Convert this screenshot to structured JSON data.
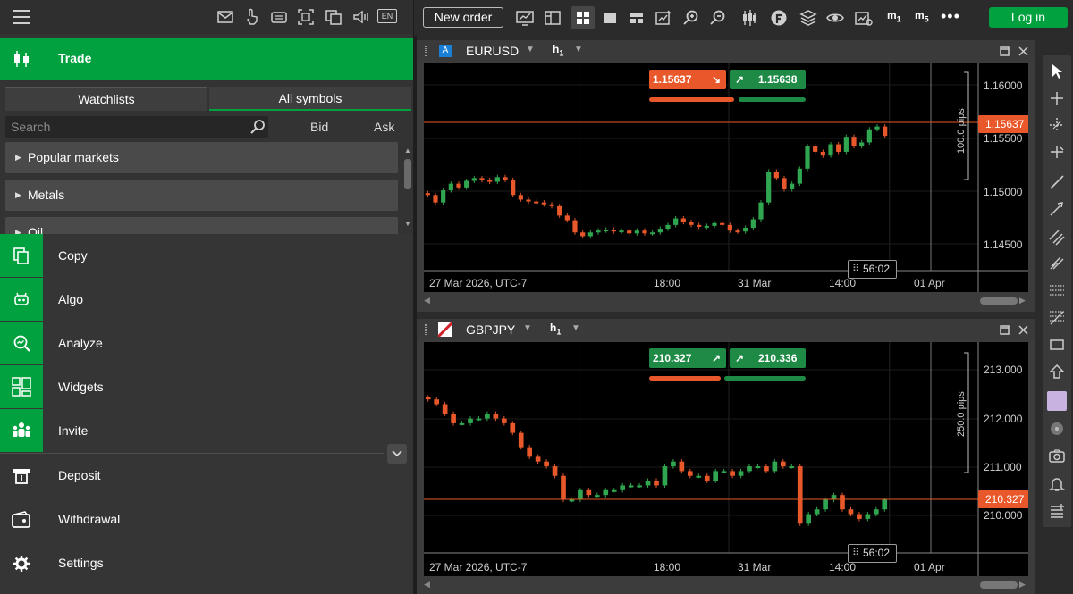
{
  "left": {
    "language": "EN",
    "trade_label": "Trade",
    "tabs": [
      {
        "label": "Watchlists",
        "active": false
      },
      {
        "label": "All symbols",
        "active": true
      }
    ],
    "search": {
      "placeholder": "Search",
      "value": ""
    },
    "columns": {
      "bid": "Bid",
      "ask": "Ask"
    },
    "categories": [
      "Popular markets",
      "Metals",
      "Oil"
    ],
    "menu": [
      {
        "label": "Copy",
        "icon": "copy-icon"
      },
      {
        "label": "Algo",
        "icon": "robot-icon"
      },
      {
        "label": "Analyze",
        "icon": "analyze-icon"
      },
      {
        "label": "Widgets",
        "icon": "widgets-icon"
      },
      {
        "label": "Invite",
        "icon": "invite-icon"
      },
      {
        "label": "Deposit",
        "icon": "deposit-icon"
      },
      {
        "label": "Withdrawal",
        "icon": "withdrawal-icon"
      },
      {
        "label": "Settings",
        "icon": "gear-icon"
      }
    ]
  },
  "toolbar": {
    "new_order": "New order",
    "login": "Log in",
    "m1": "m",
    "m1_sub": "1",
    "m5": "m",
    "m5_sub": "5"
  },
  "colors": {
    "accent": "#00a13e",
    "sell": "#e8582a",
    "buy": "#1e8a46",
    "up_candle": "#2fa64f",
    "down_candle": "#e8582a"
  },
  "charts": [
    {
      "symbol": "EURUSD",
      "badge": "A",
      "timeframe": "h",
      "timeframe_sub": "1",
      "sell_price": "1.15637",
      "buy_price": "1.15638",
      "current_price": "1.15637",
      "pips_label": "100.0 pips",
      "timer": "56:02",
      "price_ticks": [
        "1.16000",
        "1.15500",
        "1.15000",
        "1.14500"
      ],
      "time_ticks": [
        "27 Mar 2026, UTC-7",
        "18:00",
        "31 Mar",
        "14:00",
        "01 Apr"
      ]
    },
    {
      "symbol": "GBPJPY",
      "timeframe": "h",
      "timeframe_sub": "1",
      "sell_price": "210.327",
      "buy_price": "210.336",
      "current_price": "210.327",
      "pips_label": "250.0 pips",
      "timer": "56:02",
      "price_ticks": [
        "213.000",
        "212.000",
        "211.000",
        "210.000"
      ],
      "time_ticks": [
        "27 Mar 2026, UTC-7",
        "18:00",
        "31 Mar",
        "14:00",
        "01 Apr"
      ]
    }
  ],
  "chart_data": [
    {
      "type": "candlestick",
      "symbol": "EURUSD",
      "ylim": [
        1.1425,
        1.1625
      ],
      "closes": [
        1.15,
        1.1492,
        1.1505,
        1.1512,
        1.1508,
        1.1515,
        1.1518,
        1.1516,
        1.1514,
        1.1519,
        1.1516,
        1.15,
        1.1495,
        1.1493,
        1.1492,
        1.149,
        1.1488,
        1.1478,
        1.1473,
        1.146,
        1.1456,
        1.146,
        1.1462,
        1.1463,
        1.1461,
        1.1462,
        1.1459,
        1.1462,
        1.1459,
        1.146,
        1.1464,
        1.1468,
        1.1475,
        1.1471,
        1.1468,
        1.1466,
        1.1467,
        1.147,
        1.1468,
        1.1462,
        1.1461,
        1.1465,
        1.1474,
        1.1492,
        1.1525,
        1.1518,
        1.1506,
        1.1512,
        1.1528,
        1.1552,
        1.1546,
        1.1542,
        1.1554,
        1.1546,
        1.1562,
        1.1552,
        1.1556,
        1.157,
        1.1573,
        1.1563
      ]
    },
    {
      "type": "candlestick",
      "symbol": "GBPJPY",
      "ylim": [
        209.3,
        213.3
      ],
      "closes": [
        212.4,
        212.3,
        212.1,
        211.9,
        211.9,
        212.0,
        212.0,
        212.1,
        212.0,
        211.9,
        211.7,
        211.4,
        211.2,
        211.1,
        211.0,
        210.8,
        210.3,
        210.3,
        210.5,
        210.4,
        210.4,
        210.5,
        210.5,
        210.6,
        210.6,
        210.6,
        210.7,
        210.6,
        211.0,
        211.1,
        210.9,
        210.8,
        210.8,
        210.7,
        210.9,
        210.9,
        210.8,
        210.9,
        211.0,
        211.0,
        210.9,
        211.1,
        211.0,
        211.0,
        209.8,
        210.0,
        210.1,
        210.3,
        210.4,
        210.1,
        210.0,
        209.9,
        210.0,
        210.1,
        210.3
      ]
    }
  ]
}
